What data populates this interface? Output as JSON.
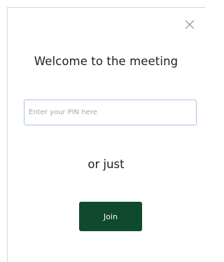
{
  "dialog": {
    "title": "Welcome to the meeting",
    "pin_input": {
      "value": "",
      "placeholder": "Enter your PIN here"
    },
    "or_text": "or just",
    "join_label": "Join",
    "close_icon": "close-icon"
  },
  "colors": {
    "join_button_bg": "#0f4a2f",
    "input_border": "#a9c3e3"
  }
}
